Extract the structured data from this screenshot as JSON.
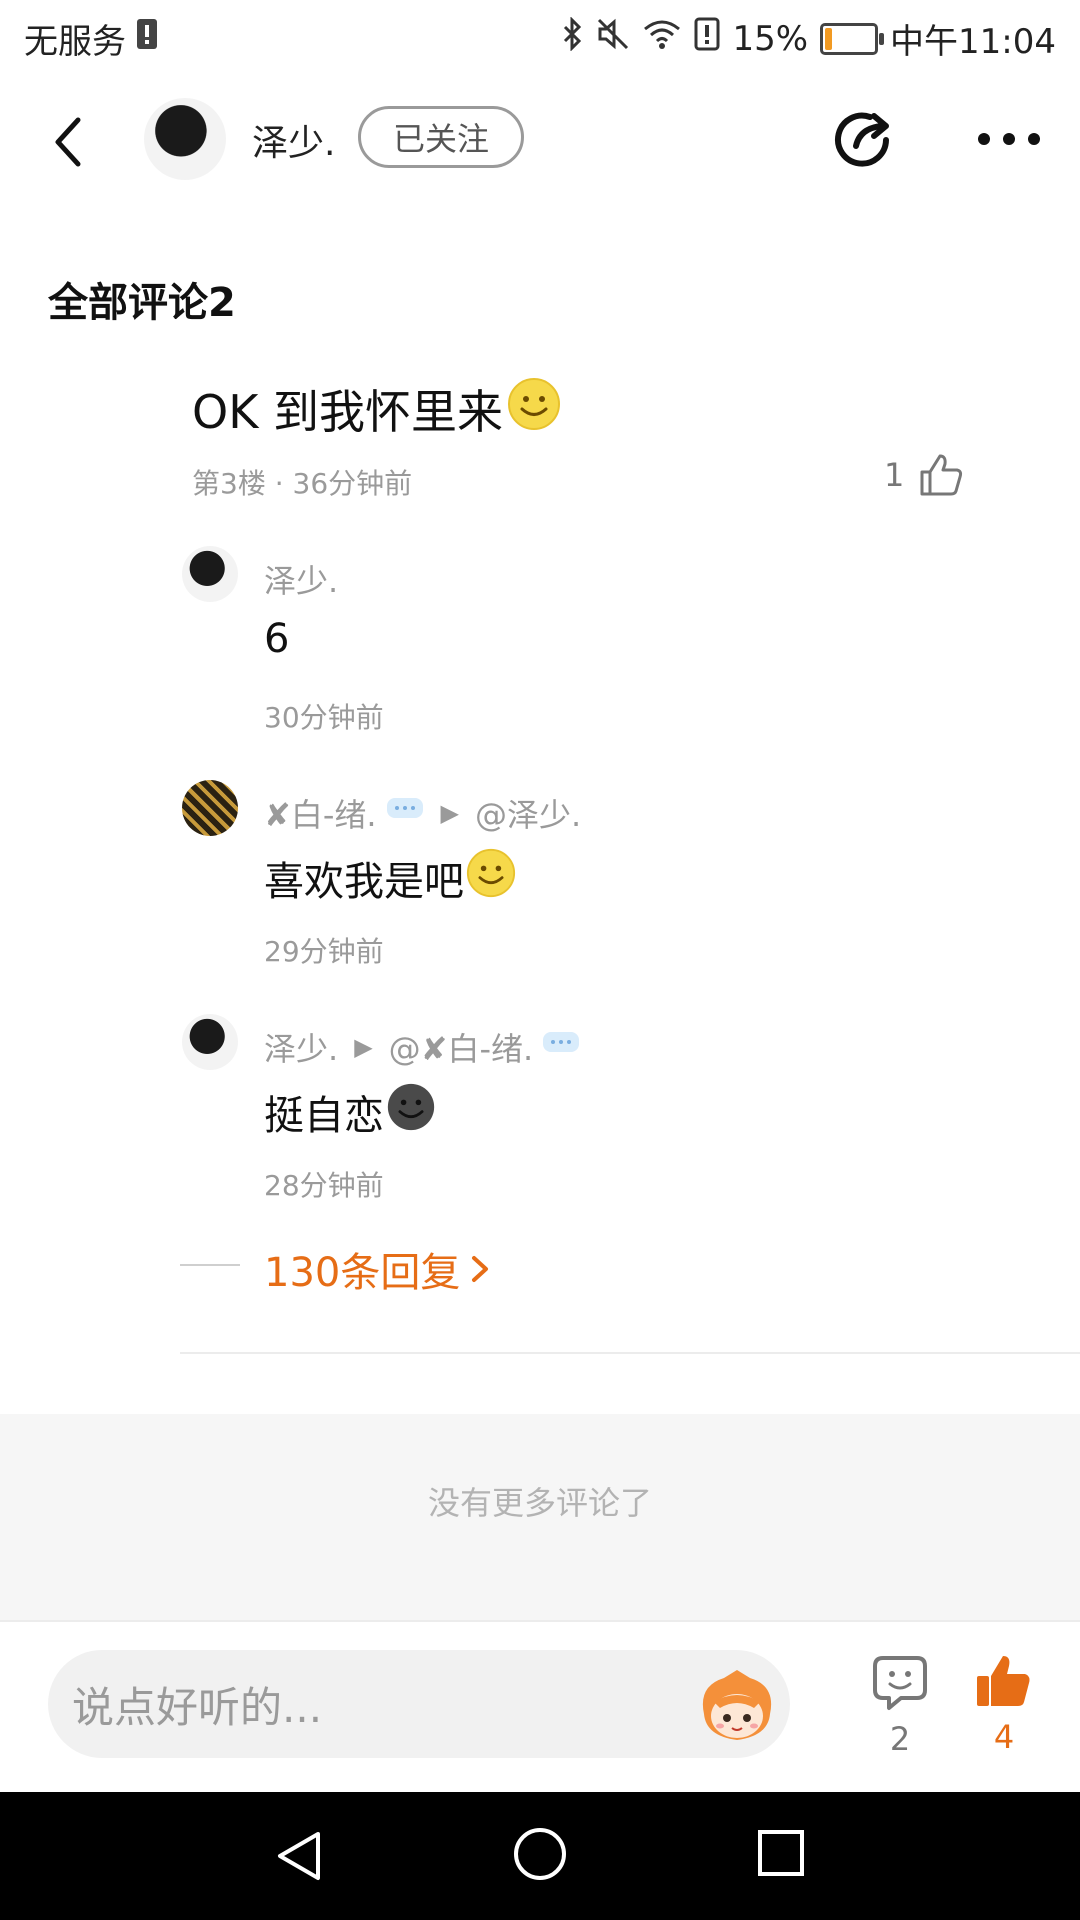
{
  "status_bar": {
    "carrier": "无服务",
    "battery_percent": "15%",
    "battery_level": 0.15,
    "time": "中午11:04"
  },
  "header": {
    "username": "泽少.",
    "follow_label": "已关注"
  },
  "section": {
    "title": "全部评论2"
  },
  "comment": {
    "text": "OK  到我怀里来",
    "meta": "第3楼 · 36分钟前",
    "likes": "1"
  },
  "replies": [
    {
      "name": "泽少.",
      "arrow": "",
      "target": "",
      "text": "6",
      "time": "30分钟前"
    },
    {
      "name": "✘白-绪.",
      "arrow": "▶",
      "target": "@泽少.",
      "text": "喜欢我是吧",
      "time": "29分钟前"
    },
    {
      "name": "泽少.",
      "arrow": "▶",
      "target": "@✘白-绪.",
      "text": "挺自恋",
      "time": "28分钟前"
    }
  ],
  "more_replies": "130条回复",
  "no_more": "没有更多评论了",
  "bottom_bar": {
    "input_placeholder": "说点好听的...",
    "comment_count": "2",
    "like_count": "4"
  },
  "colors": {
    "accent": "#e66d16",
    "muted": "#9a9a9a",
    "battery": "#f29a22"
  },
  "icons": [
    "back-icon",
    "share-icon",
    "more-icon",
    "like-icon",
    "comment-icon",
    "thumb-filled-icon",
    "smile-emoji-icon",
    "dark-emoji-icon",
    "chevron-right-icon",
    "mascot-icon",
    "nav-back-icon",
    "nav-home-icon",
    "nav-recents-icon"
  ]
}
